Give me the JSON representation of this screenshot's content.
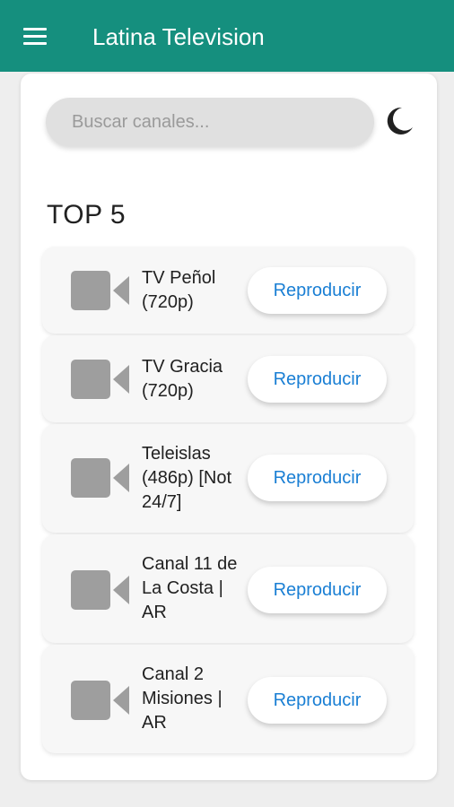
{
  "appbar": {
    "title": "Latina Television",
    "background": "#158f7e"
  },
  "search": {
    "placeholder": "Buscar canales...",
    "value": ""
  },
  "theme_toggle": {
    "icon": "moon-icon"
  },
  "section": {
    "title": "TOP 5"
  },
  "channels": [
    {
      "name": "TV Peñol (720p)",
      "button_label": "Reproducir",
      "icon": "video-camera-icon"
    },
    {
      "name": "TV Gracia (720p)",
      "button_label": "Reproducir",
      "icon": "video-camera-icon"
    },
    {
      "name": "Teleislas (486p) [Not 24/7]",
      "button_label": "Reproducir",
      "icon": "video-camera-icon"
    },
    {
      "name": "Canal 11 de La Costa | AR",
      "button_label": "Reproducir",
      "icon": "video-camera-icon"
    },
    {
      "name": "Canal 2 Misiones | AR",
      "button_label": "Reproducir",
      "icon": "video-camera-icon"
    }
  ],
  "colors": {
    "accent": "#158f7e",
    "button_text": "#1a7fd4",
    "icon_gray": "#9e9e9e"
  }
}
